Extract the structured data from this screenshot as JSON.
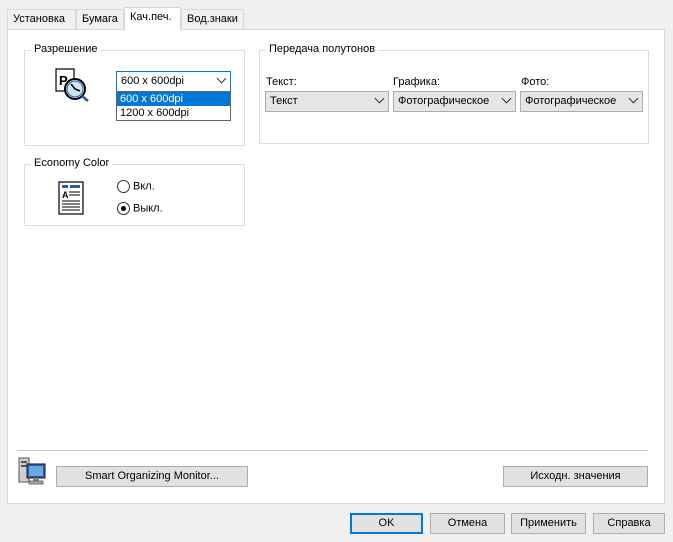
{
  "tabs": [
    {
      "label": "Установка",
      "active": false
    },
    {
      "label": "Бумага",
      "active": false
    },
    {
      "label": "Кач.печ.",
      "active": true
    },
    {
      "label": "Вод.знаки",
      "active": false
    }
  ],
  "resolution": {
    "legend": "Разрешение",
    "selected": "600 x 600dpi",
    "options": [
      "600 x 600dpi",
      "1200 x 600dpi"
    ],
    "highlighted": "600 x 600dpi",
    "icon": "printer-clock-icon"
  },
  "halftone": {
    "legend": "Передача полутонов",
    "text_label": "Текст:",
    "text_value": "Текст",
    "graphics_label": "Графика:",
    "graphics_value": "Фотографическое",
    "photo_label": "Фото:",
    "photo_value": "Фотографическое"
  },
  "economy": {
    "legend": "Economy Color",
    "on_label": "Вкл.",
    "off_label": "Выкл.",
    "selected": "off",
    "icon": "document-page-icon"
  },
  "bottom": {
    "monitor_button": "Smart Organizing Monitor...",
    "defaults_button": "Исходн. значения",
    "monitor_icon": "computer-monitor-icon"
  },
  "dialog_buttons": {
    "ok": "OK",
    "cancel": "Отмена",
    "apply": "Применить",
    "help": "Справка"
  },
  "colors": {
    "accent": "#0078d7",
    "button_face": "#e1e1e1"
  }
}
